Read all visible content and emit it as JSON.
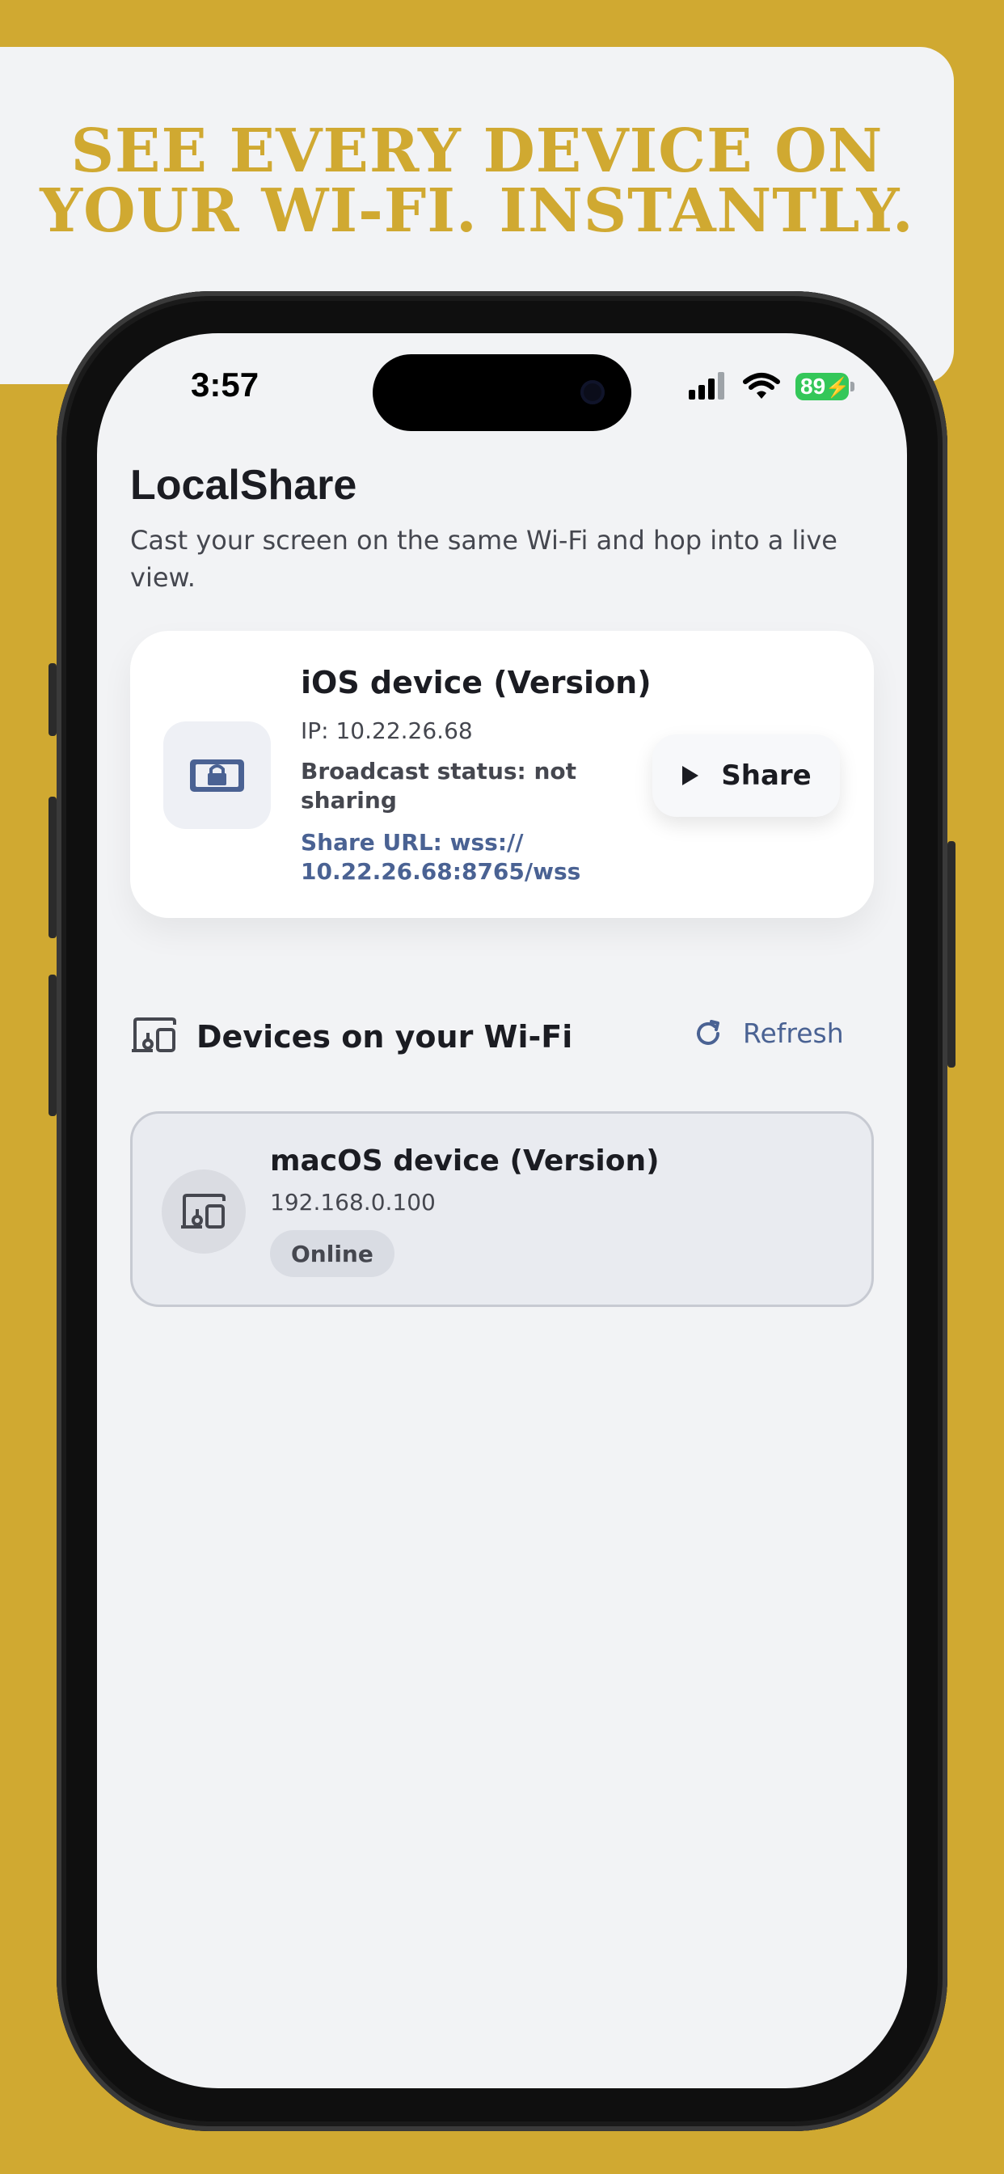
{
  "banner": {
    "headline_line1": "SEE EVERY DEVICE ON",
    "headline_line2": "YOUR WI-FI. INSTANTLY."
  },
  "status_bar": {
    "time": "3:57",
    "battery": "89"
  },
  "app": {
    "title": "LocalShare",
    "subtitle": "Cast your screen on the same Wi-Fi and hop into a live view."
  },
  "this_device": {
    "title": "iOS device (Version)",
    "ip": "IP: 10.22.26.68",
    "status": "Broadcast status: not sharing",
    "share_url": "Share URL: wss:// 10.22.26.68:8765/wss",
    "share_label": "Share"
  },
  "devices": {
    "section_title": "Devices on your Wi-Fi",
    "refresh_label": "Refresh",
    "items": [
      {
        "name": "macOS device (Version)",
        "ip": "192.168.0.100",
        "status": "Online"
      }
    ]
  },
  "colors": {
    "background": "#D0A931",
    "accent": "#4A6293",
    "battery": "#34C759"
  },
  "icons": [
    "lock-screen-icon",
    "play-icon",
    "devices-icon",
    "refresh-icon",
    "signal-icon",
    "wifi-icon",
    "battery-icon"
  ]
}
